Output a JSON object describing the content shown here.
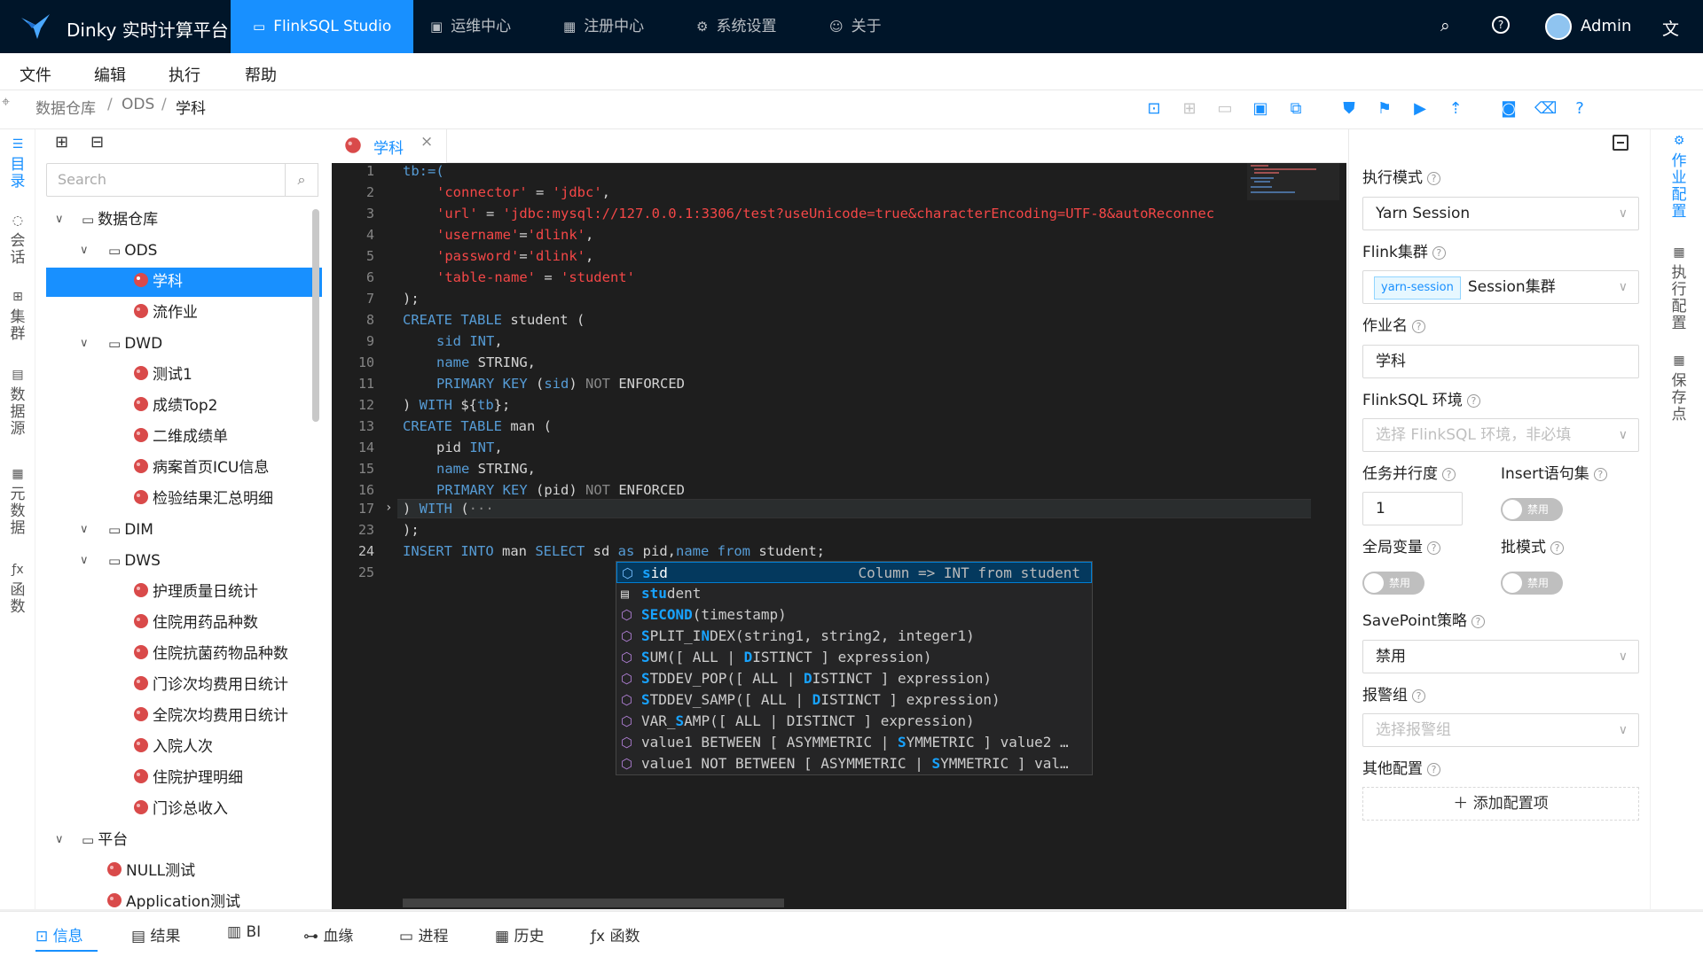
{
  "header": {
    "app_title": "Dinky 实时计算平台",
    "nav": [
      "FlinkSQL Studio",
      "运维中心",
      "注册中心",
      "系统设置",
      "关于"
    ],
    "user": "Admin"
  },
  "menu": [
    "文件",
    "编辑",
    "执行",
    "帮助"
  ],
  "breadcrumb": [
    "数据仓库",
    "ODS",
    "学科"
  ],
  "left_rail": [
    "目录",
    "会话",
    "集群",
    "数据源",
    "元数据",
    "函数"
  ],
  "right_rail": [
    "作业配置",
    "执行配置",
    "保存点"
  ],
  "tree": {
    "search_placeholder": "Search",
    "nodes": [
      "数据仓库",
      "ODS",
      "学科",
      "流作业",
      "DWD",
      "测试1",
      "成绩Top2",
      "二维成绩单",
      "病案首页ICU信息",
      "检验结果汇总明细",
      "DIM",
      "DWS",
      "护理质量日统计",
      "住院用药品种数",
      "住院抗菌药物品种数",
      "门诊次均费用日统计",
      "全院次均费用日统计",
      "入院人次",
      "住院护理明细",
      "门诊总收入",
      "平台",
      "NULL测试",
      "Application测试"
    ]
  },
  "editor": {
    "tab": "学科",
    "line_numbers": [
      "1",
      "2",
      "3",
      "4",
      "5",
      "6",
      "7",
      "8",
      "9",
      "10",
      "11",
      "12",
      "13",
      "14",
      "15",
      "16",
      "17",
      "23",
      "24",
      "25"
    ],
    "lines": {
      "l1": "tb:=(",
      "l2a": "'connector'",
      "l2b": " = ",
      "l2c": "'jdbc'",
      "l2d": ",",
      "l3a": "'url'",
      "l3b": " = ",
      "l3c": "'jdbc:mysql://127.0.0.1:3306/test?useUnicode=true&characterEncoding=UTF-8&autoReconnec",
      "l4a": "'username'",
      "l4b": "=",
      "l4c": "'dlink'",
      "l4d": ",",
      "l5a": "'password'",
      "l5b": "=",
      "l5c": "'dlink'",
      "l5d": ",",
      "l6a": "'table-name'",
      "l6b": " = ",
      "l6c": "'student'",
      "l7": ");",
      "l8a": "CREATE TABLE",
      "l8b": " student (",
      "l9a": "sid",
      "l9b": " INT",
      "l9c": ",",
      "l10a": "name",
      "l10b": " STRING,",
      "l11a": "PRIMARY KEY",
      "l11b": " (",
      "l11c": "sid",
      "l11d": ") ",
      "l11e": "NOT",
      "l11f": " ENFORCED",
      "l12a": ") ",
      "l12b": "WITH",
      "l12c": " ${",
      "l12d": "tb",
      "l12e": "};",
      "l13a": "CREATE TABLE",
      "l13b": " man (",
      "l14a": "pid",
      "l14b": " INT",
      "l14c": ",",
      "l15a": "name",
      "l15b": " STRING,",
      "l16a": "PRIMARY KEY",
      "l16b": " (pid) ",
      "l16c": "NOT",
      "l16d": " ENFORCED",
      "l17a": ") ",
      "l17b": "WITH",
      "l17c": " (",
      "l17d": "···",
      "l23": ");",
      "l24a": "INSERT INTO",
      "l24b": " man ",
      "l24c": "SELECT",
      "l24d": " sd ",
      "l24e": "as",
      "l24f": " pid,",
      "l24g": "name",
      "l24h": " ",
      "l24i": "from",
      "l24j": " student;"
    }
  },
  "suggestions": [
    {
      "hl": "s",
      "rest": "id",
      "detail": "Column => INT from student",
      "icon": "column-icon"
    },
    {
      "hl": "stu",
      "rest": "dent",
      "detail": "",
      "icon": "table-icon"
    },
    {
      "hl": "SECOND",
      "rest": "(timestamp)",
      "detail": "",
      "icon": "function-icon"
    },
    {
      "hl": "S",
      "rest": "PLIT_I",
      "post": "N",
      "post2": "DEX(string1, string2, integer1)",
      "detail": "",
      "icon": "function-icon"
    },
    {
      "hl": "S",
      "rest": "UM([ ALL | ",
      "post": "D",
      "post2": "ISTINCT ] expression)",
      "detail": "",
      "icon": "function-icon"
    },
    {
      "hl": "S",
      "rest": "TDDEV_POP([ ALL | ",
      "post": "D",
      "post2": "ISTINCT ] expression)",
      "detail": "",
      "icon": "function-icon"
    },
    {
      "hl": "S",
      "rest": "TDDEV_SAMP([ ALL | ",
      "post": "D",
      "post2": "ISTINCT ] expression)",
      "detail": "",
      "icon": "function-icon"
    },
    {
      "hl": "",
      "rest": "VAR_",
      "post": "S",
      "post2": "AMP([ ALL | DISTINCT ] expression)",
      "detail": "",
      "icon": "function-icon"
    },
    {
      "hl": "",
      "rest": "value1 BETWEEN [ ASYMMETRIC | ",
      "post": "S",
      "post2": "YMMETRIC ] value2 …",
      "detail": "",
      "icon": "function-icon"
    },
    {
      "hl": "",
      "rest": "value1 NOT BETWEEN [ ASYMMETRIC | ",
      "post": "S",
      "post2": "YMMETRIC ] val…",
      "detail": "",
      "icon": "function-icon"
    }
  ],
  "config": {
    "exec_mode_label": "执行模式",
    "exec_mode_value": "Yarn Session",
    "cluster_label": "Flink集群",
    "cluster_tag": "yarn-session",
    "cluster_value": "Session集群",
    "job_name_label": "作业名",
    "job_name_value": "学科",
    "env_label": "FlinkSQL 环境",
    "env_placeholder": "选择 FlinkSQL 环境，非必填",
    "parallelism_label": "任务并行度",
    "parallelism_value": "1",
    "insert_set_label": "Insert语句集",
    "insert_set_state": "禁用",
    "global_var_label": "全局变量",
    "global_var_state": "禁用",
    "batch_mode_label": "批模式",
    "batch_mode_state": "禁用",
    "savepoint_label": "SavePoint策略",
    "savepoint_value": "禁用",
    "alert_label": "报警组",
    "alert_placeholder": "选择报警组",
    "other_label": "其他配置",
    "add_config": "添加配置项"
  },
  "bottom_tabs": [
    "信息",
    "结果",
    "BI",
    "血缘",
    "进程",
    "历史",
    "函数"
  ],
  "colors": {
    "header_bg": "#001529",
    "primary": "#1890ff",
    "editor_bg": "#1e1e1e",
    "keyword": "#569cd6",
    "string": "#ce9178"
  }
}
